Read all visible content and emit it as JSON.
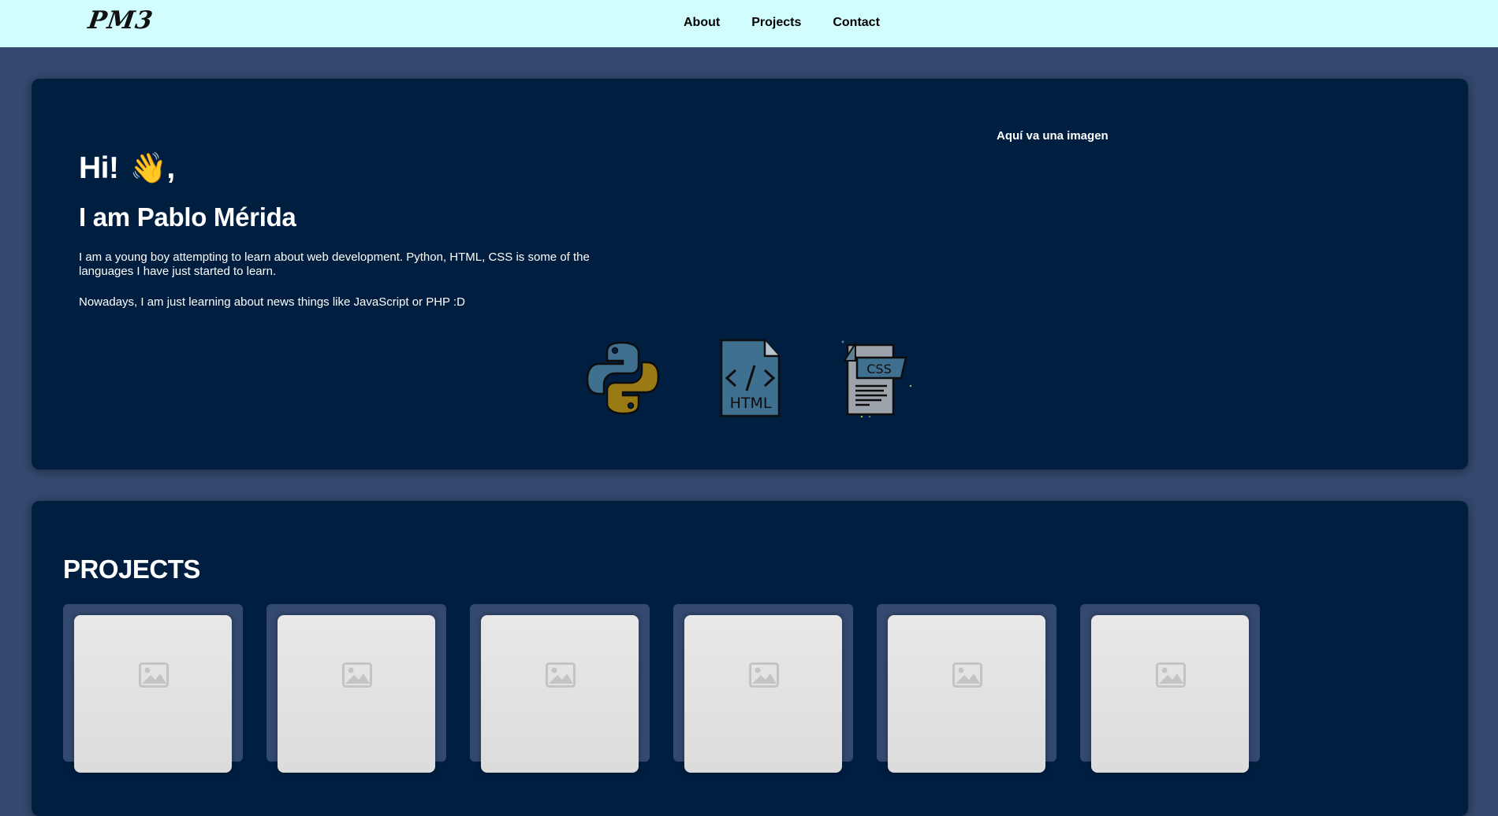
{
  "navbar": {
    "logo": "PM3",
    "links": [
      "About",
      "Projects",
      "Contact"
    ]
  },
  "hero": {
    "greeting": "Hi!",
    "greeting_emoji": "👋",
    "greeting_punct": ",",
    "name": "I am Pablo Mérida",
    "bio": "I am a young boy attempting to learn about web development. Python, HTML, CSS is some of the languages I have just started to learn.",
    "bio2": "Nowadays, I am just learning about news things like JavaScript or PHP :D",
    "image_placeholder": "Aquí va una imagen",
    "skills": [
      {
        "icon": "python-icon"
      },
      {
        "icon": "html-file-icon",
        "label": "HTML"
      },
      {
        "icon": "css-file-icon",
        "label": "CSS"
      }
    ]
  },
  "projects": {
    "title": "PROJECTS",
    "items": [
      {
        "thumbnail": "image-placeholder-icon"
      },
      {
        "thumbnail": "image-placeholder-icon"
      },
      {
        "thumbnail": "image-placeholder-icon"
      },
      {
        "thumbnail": "image-placeholder-icon"
      },
      {
        "thumbnail": "image-placeholder-icon"
      },
      {
        "thumbnail": "image-placeholder-icon"
      }
    ]
  },
  "colors": {
    "page_bg": "#34496f",
    "navbar_bg": "#d2fdff",
    "card_bg": "#001e40",
    "text": "#ffffff"
  }
}
